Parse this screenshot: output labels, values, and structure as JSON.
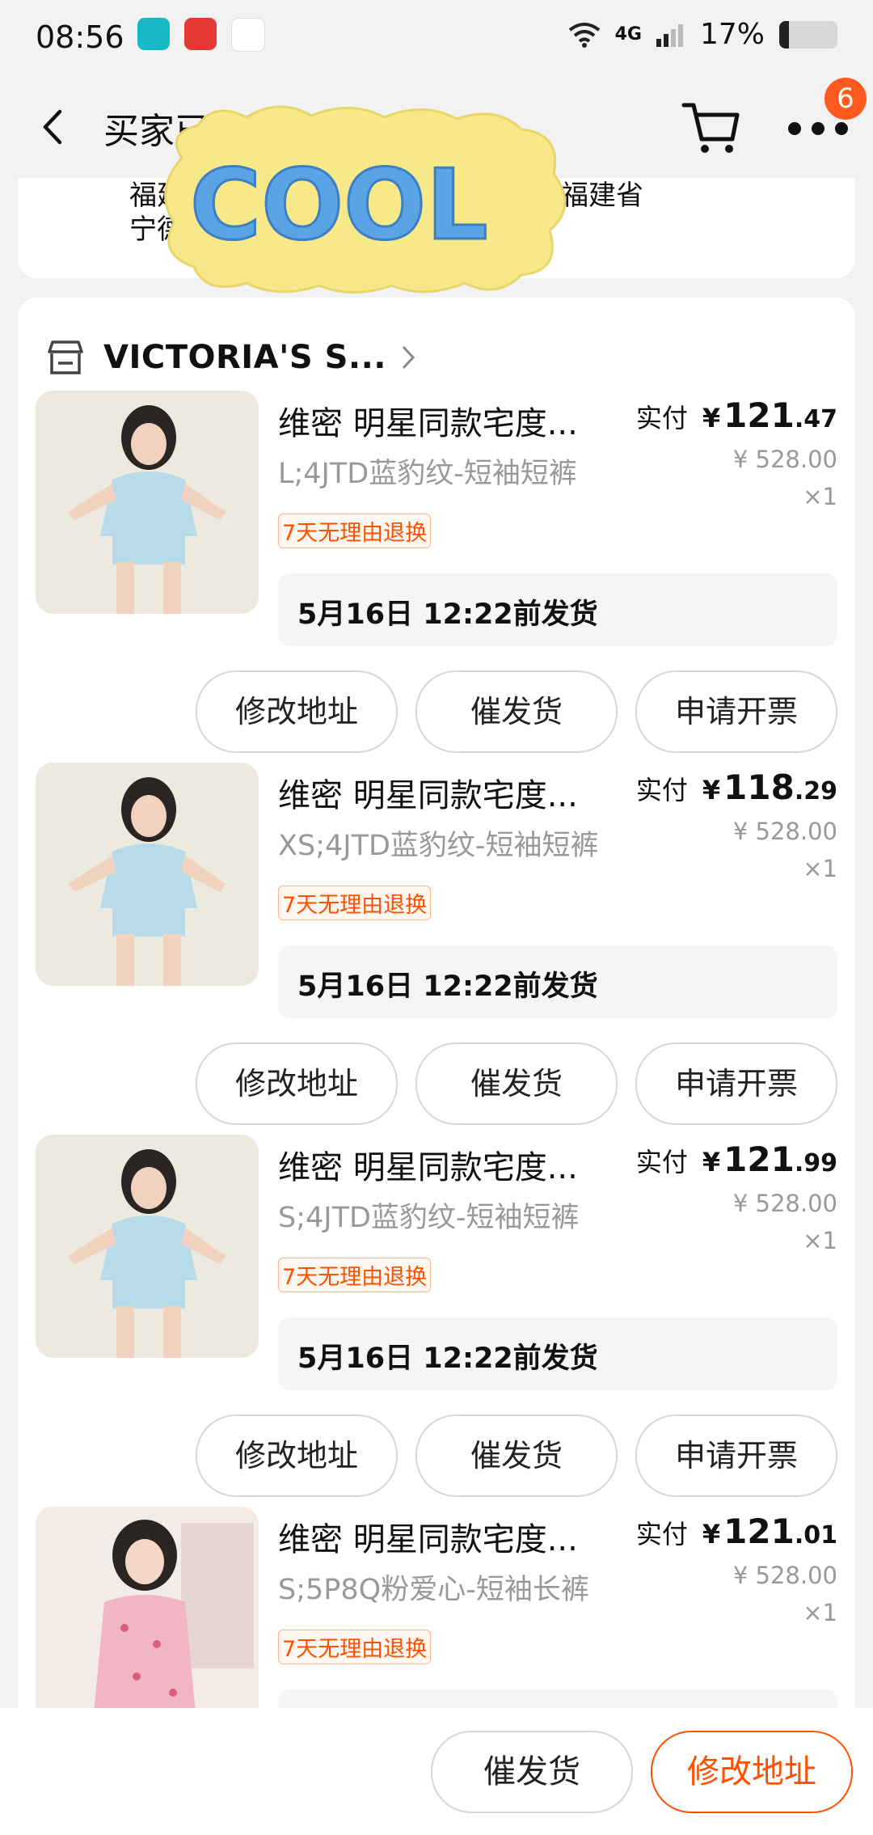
{
  "status_bar": {
    "time": "08:56",
    "network": "4G",
    "battery": "17%",
    "battery_level": 0.17
  },
  "header": {
    "title": "买家已",
    "cart_badge": "6"
  },
  "address": {
    "line1": "福建",
    "line2": "宁德",
    "line1_right": "福建省"
  },
  "sticker": {
    "text": "COOL"
  },
  "store": {
    "name": "VICTORIA'S S..."
  },
  "items": [
    {
      "title": "维密 明星同款宅度...",
      "sku": "L;4JTD蓝豹纹-短袖短裤",
      "tag": "7天无理由退换",
      "paid_label": "实付",
      "currency": "¥",
      "price_int": "121",
      "price_dec": ".47",
      "orig_price": "¥ 528.00",
      "qty": "×1",
      "ship": "5月16日 12:22前发货",
      "btn1": "修改地址",
      "btn2": "催发货",
      "btn3": "申请开票"
    },
    {
      "title": "维密 明星同款宅度...",
      "sku": "XS;4JTD蓝豹纹-短袖短裤",
      "tag": "7天无理由退换",
      "paid_label": "实付",
      "currency": "¥",
      "price_int": "118",
      "price_dec": ".29",
      "orig_price": "¥ 528.00",
      "qty": "×1",
      "ship": "5月16日 12:22前发货",
      "btn1": "修改地址",
      "btn2": "催发货",
      "btn3": "申请开票"
    },
    {
      "title": "维密 明星同款宅度...",
      "sku": "S;4JTD蓝豹纹-短袖短裤",
      "tag": "7天无理由退换",
      "paid_label": "实付",
      "currency": "¥",
      "price_int": "121",
      "price_dec": ".99",
      "orig_price": "¥ 528.00",
      "qty": "×1",
      "ship": "5月16日 12:22前发货",
      "btn1": "修改地址",
      "btn2": "催发货",
      "btn3": "申请开票"
    },
    {
      "title": "维密 明星同款宅度...",
      "sku": "S;5P8Q粉爱心-短袖长裤",
      "tag": "7天无理由退换",
      "paid_label": "实付",
      "currency": "¥",
      "price_int": "121",
      "price_dec": ".01",
      "orig_price": "¥ 528.00",
      "qty": "×1",
      "ship": "",
      "btn1": "",
      "btn2": "",
      "btn3": ""
    }
  ],
  "bottom_bar": {
    "urge_label": "催发货",
    "change_address_label": "修改地址"
  },
  "colors": {
    "accent": "#ff5000",
    "badge": "#ff5a1f",
    "background": "#f2f2f2"
  }
}
